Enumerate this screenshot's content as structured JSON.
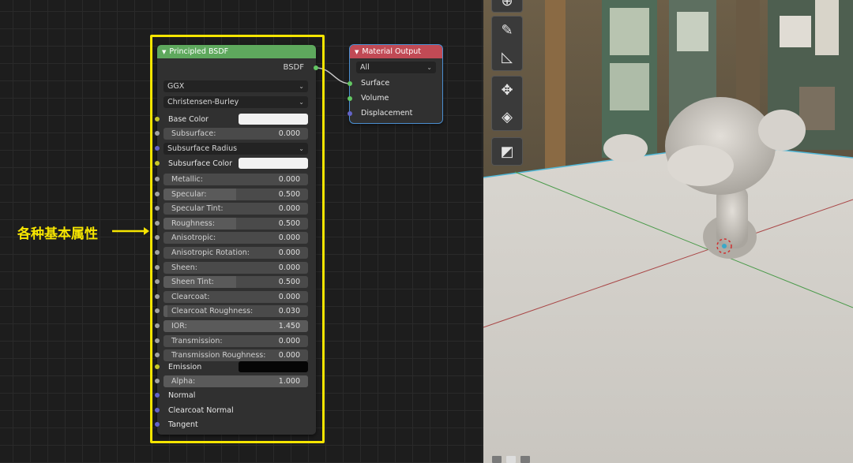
{
  "principled": {
    "title": "Principled BSDF",
    "output_label": "BSDF",
    "distribution": "GGX",
    "subsurface_method": "Christensen-Burley",
    "base_color": {
      "label": "Base Color",
      "color": "#f2f2f2"
    },
    "subsurface": {
      "label": "Subsurface:",
      "value": "0.000",
      "fill": 0
    },
    "subsurface_radius": {
      "label": "Subsurface Radius"
    },
    "subsurface_color": {
      "label": "Subsurface Color",
      "color": "#f2f2f2"
    },
    "sliders": [
      {
        "label": "Metallic:",
        "value": "0.000",
        "fill": 0
      },
      {
        "label": "Specular:",
        "value": "0.500",
        "fill": 0.5
      },
      {
        "label": "Specular Tint:",
        "value": "0.000",
        "fill": 0
      },
      {
        "label": "Roughness:",
        "value": "0.500",
        "fill": 0.5
      },
      {
        "label": "Anisotropic:",
        "value": "0.000",
        "fill": 0
      },
      {
        "label": "Anisotropic Rotation:",
        "value": "0.000",
        "fill": 0
      },
      {
        "label": "Sheen:",
        "value": "0.000",
        "fill": 0
      },
      {
        "label": "Sheen Tint:",
        "value": "0.500",
        "fill": 0.5
      },
      {
        "label": "Clearcoat:",
        "value": "0.000",
        "fill": 0
      },
      {
        "label": "Clearcoat Roughness:",
        "value": "0.030",
        "fill": 0.03
      },
      {
        "label": "IOR:",
        "value": "1.450",
        "fill": 1
      },
      {
        "label": "Transmission:",
        "value": "0.000",
        "fill": 0
      },
      {
        "label": "Transmission Roughness:",
        "value": "0.000",
        "fill": 0
      }
    ],
    "emission": {
      "label": "Emission",
      "color": "#050505"
    },
    "alpha": {
      "label": "Alpha:",
      "value": "1.000",
      "fill": 1
    },
    "normal": "Normal",
    "clearcoat_normal": "Clearcoat Normal",
    "tangent": "Tangent"
  },
  "material_output": {
    "title": "Material Output",
    "target": "All",
    "inputs": [
      "Surface",
      "Volume",
      "Displacement"
    ]
  },
  "annotation": {
    "text": "各种基本属性"
  },
  "toolbar_icons": [
    "annotate-icon",
    "measure-icon",
    "move-view-icon",
    "orbit-view-icon",
    "camera-view-icon"
  ],
  "colors": {
    "bsdf_header": "#5ea85d",
    "output_header": "#c14a55",
    "highlight": "#f6e500"
  }
}
